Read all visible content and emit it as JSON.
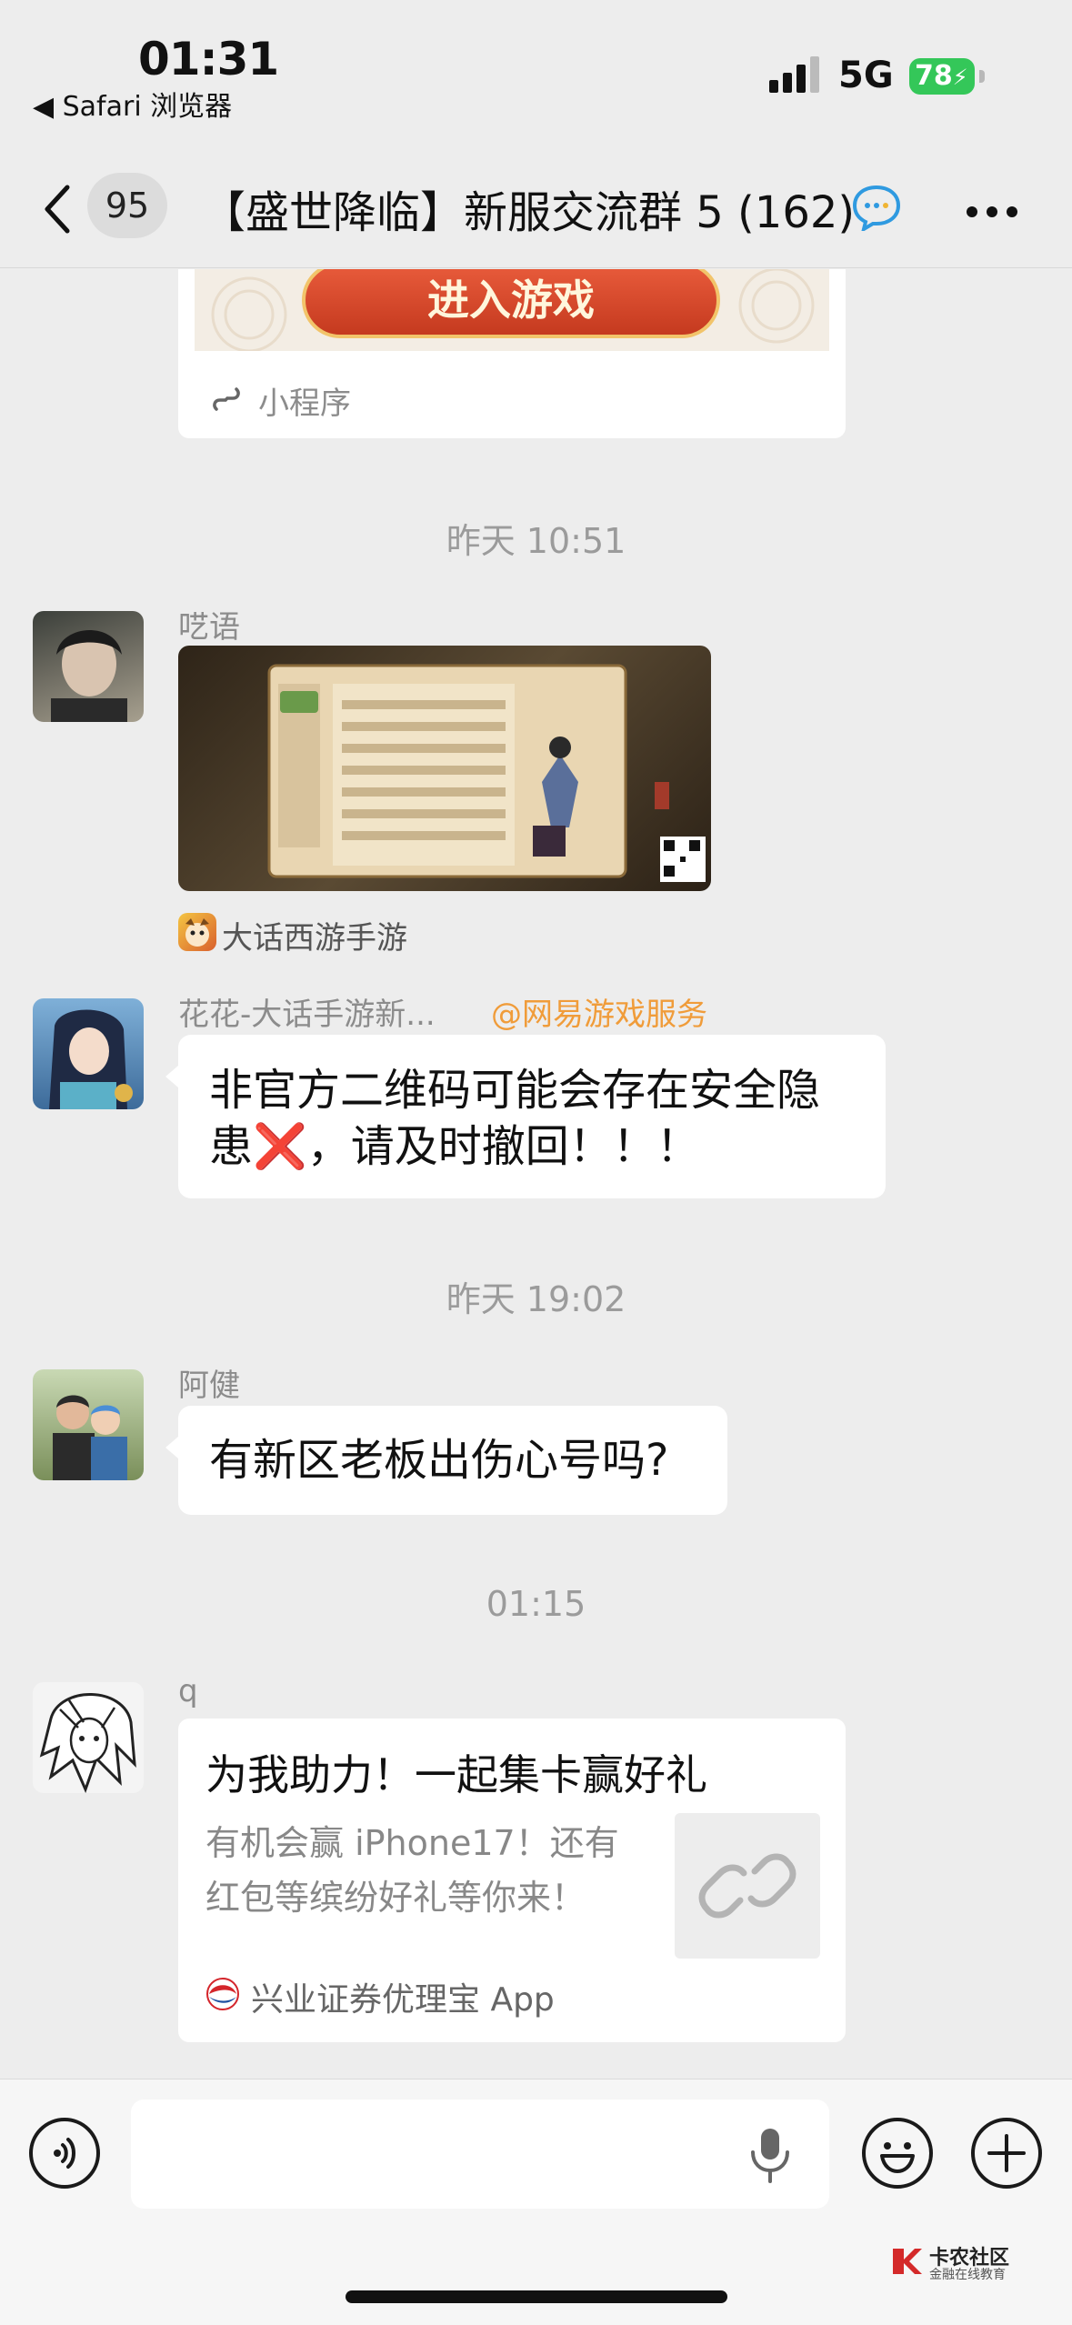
{
  "status_bar": {
    "time": "01:31",
    "back_app": "◀ Safari 浏览器",
    "network": "5G",
    "battery": "78"
  },
  "nav": {
    "unread_count": "95",
    "title": "【盛世降临】新服交流群 5 (162)"
  },
  "messages": {
    "mini_program": {
      "button_text": "进入游戏",
      "source_label": "小程序"
    },
    "time_1": "昨天 10:51",
    "msg_1": {
      "sender": "呓语",
      "source_label": "大话西游手游"
    },
    "msg_2": {
      "sender": "花花-大话手游新...",
      "mention": "@网易游戏服务",
      "text_line1": "非官方二维码可能会存在安全隐",
      "text_line2_a": "患",
      "text_line2_emoji": "❌",
      "text_line2_b": "，请及时撤回！！！"
    },
    "time_2": "昨天 19:02",
    "msg_3": {
      "sender": "阿健",
      "text": "有新区老板出伤心号吗?"
    },
    "time_3": "01:15",
    "msg_4": {
      "sender": "q",
      "title": "为我助力！一起集卡赢好礼",
      "desc_line1": "有机会赢 iPhone17！还有",
      "desc_line2": "红包等缤纷好礼等你来！",
      "source": "兴业证券优理宝 App"
    }
  },
  "input_bar": {
    "placeholder": ""
  },
  "watermark": {
    "name": "卡农社区",
    "slogan": "金融在线教育"
  },
  "colors": {
    "background": "#ededed",
    "mention": "#f09c3a",
    "battery": "#34c759",
    "mini_button": "#d9442a"
  }
}
